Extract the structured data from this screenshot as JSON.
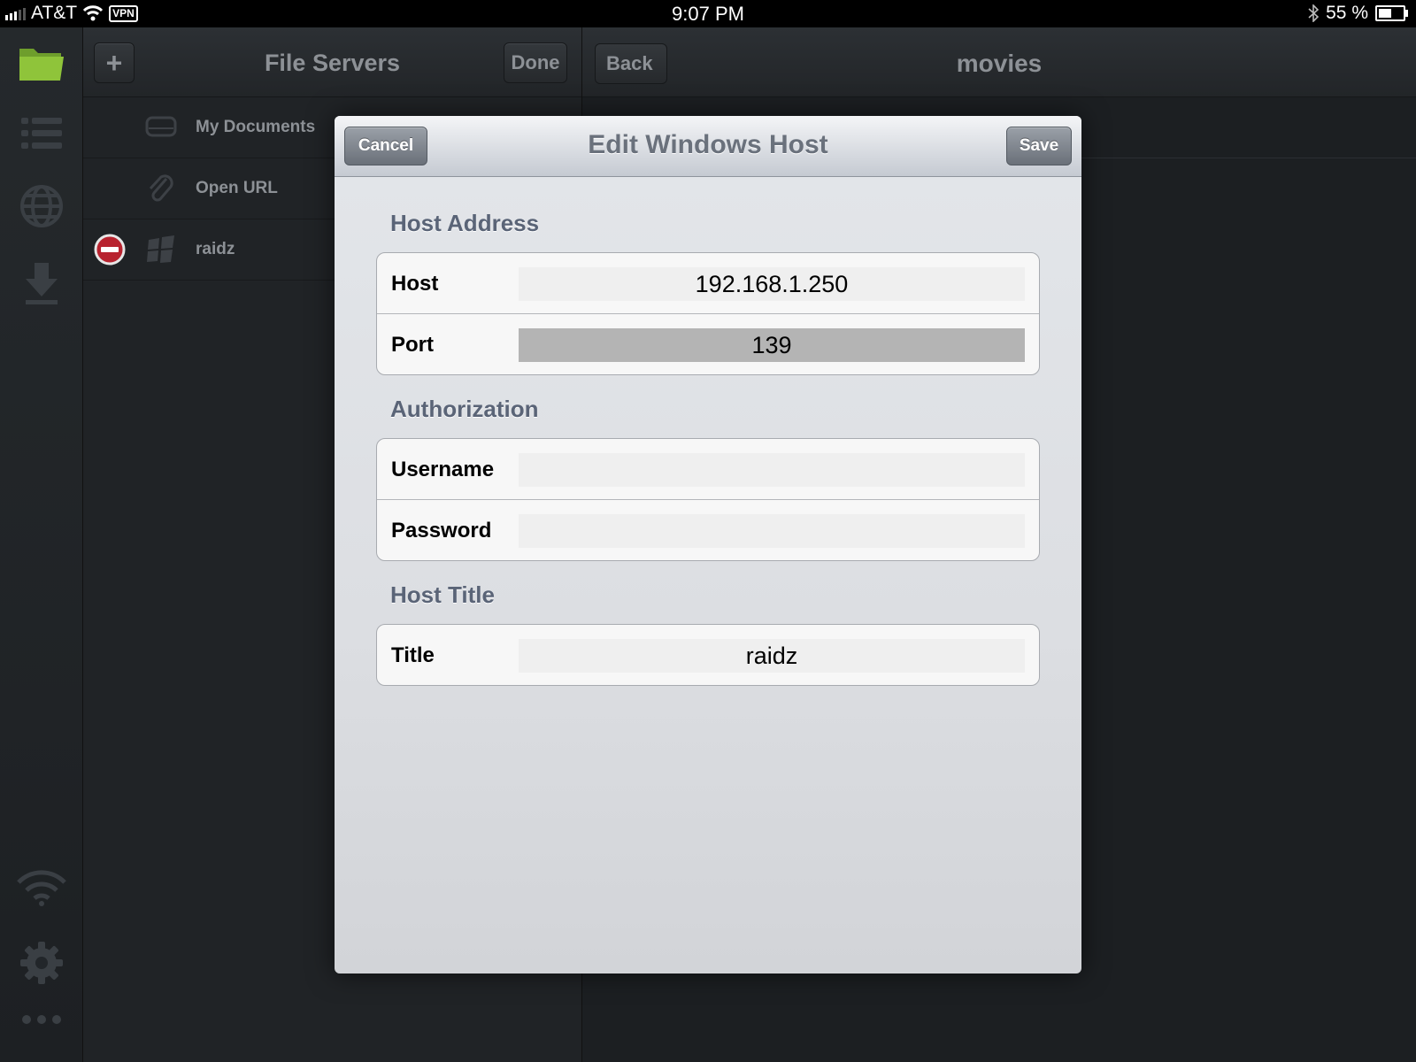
{
  "status_bar": {
    "carrier": "AT&T",
    "vpn": "VPN",
    "time": "9:07 PM",
    "battery_percent": "55 %",
    "battery_level": 0.55
  },
  "rail": {
    "icons": [
      "folder-icon",
      "list-icon",
      "globe-icon",
      "download-icon",
      "wifi-icon",
      "gear-icon",
      "more-icon"
    ],
    "active_color": "#8fc43a"
  },
  "left_panel": {
    "title": "File Servers",
    "add_label": "+",
    "done_label": "Done",
    "items": [
      {
        "label": "My Documents",
        "icon": "drive-icon"
      },
      {
        "label": "Open URL",
        "icon": "paperclip-icon"
      },
      {
        "label": "raidz",
        "icon": "windows-icon",
        "delete": true
      }
    ]
  },
  "right_panel": {
    "title": "movies",
    "back_label": "Back"
  },
  "modal": {
    "title": "Edit Windows Host",
    "cancel_label": "Cancel",
    "save_label": "Save",
    "sections": {
      "host_address": {
        "title": "Host Address",
        "host_label": "Host",
        "host_value": "192.168.1.250",
        "port_label": "Port",
        "port_value": "139"
      },
      "authorization": {
        "title": "Authorization",
        "username_label": "Username",
        "username_value": "",
        "password_label": "Password",
        "password_value": ""
      },
      "host_title": {
        "title": "Host Title",
        "title_label": "Title",
        "title_value": "raidz"
      }
    }
  }
}
